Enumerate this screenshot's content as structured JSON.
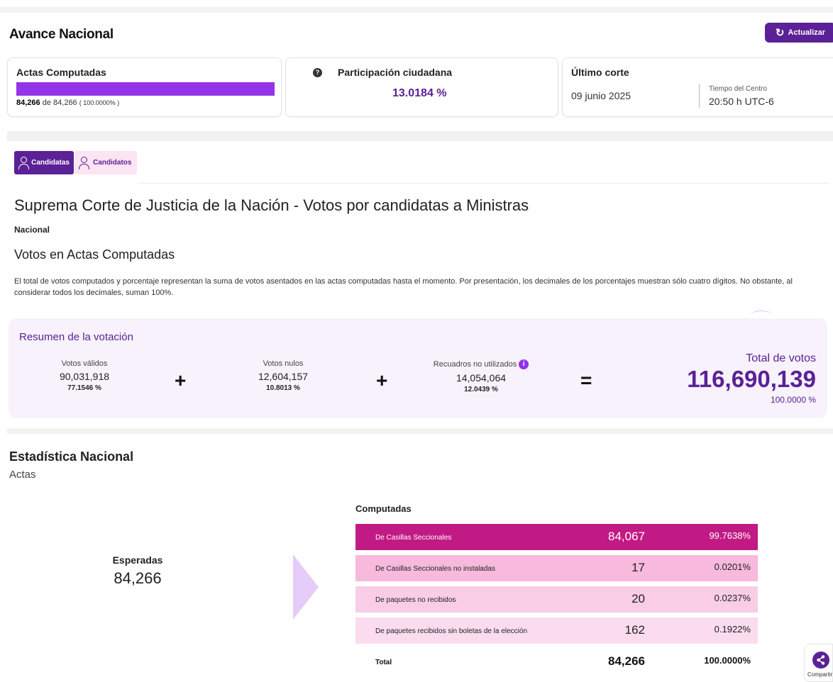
{
  "header": {
    "title": "Avance Nacional",
    "refresh_label": "Actualizar"
  },
  "actas": {
    "title": "Actas Computadas",
    "progress_fraction": 1.0,
    "computed": "84,266",
    "connector": "de",
    "total": "84,266",
    "percent": "( 100.0000% )"
  },
  "participacion": {
    "title": "Participación ciudadana",
    "value": "13.0184 %"
  },
  "corte": {
    "title": "Último corte",
    "date": "09 junio 2025",
    "time_label": "Tiempo del Centro",
    "time": "20:50 h UTC-6"
  },
  "tabs": [
    {
      "label": "Candidatas",
      "active": true
    },
    {
      "label": "Candidatos",
      "active": false
    }
  ],
  "content": {
    "title": "Suprema Corte de Justicia de la Nación - Votos por candidatas a Ministras",
    "scope": "Nacional",
    "subtitle": "Votos en Actas Computadas",
    "description": "El total de votos computados y porcentaje representan la suma de votos asentados en las actas computadas hasta el momento. Por presentación, los decimales de los porcentajes muestran sólo cuatro dígitos. No obstante, al considerar todos los decimales, suman 100%."
  },
  "resumen": {
    "title": "Resumen de la votación",
    "validos": {
      "label": "Votos válidos",
      "value": "90,031,918",
      "percent": "77.1546 %"
    },
    "nulos": {
      "label": "Votos nulos",
      "value": "12,604,157",
      "percent": "10.8013 %"
    },
    "no_utilizados": {
      "label": "Recuadros no utilizados",
      "value": "14,054,064",
      "percent": "12.0439 %"
    },
    "plus": "+",
    "equals": "=",
    "total": {
      "label": "Total de votos",
      "value": "116,690,139",
      "percent": "100.0000 %"
    }
  },
  "estadistica": {
    "title": "Estadística Nacional",
    "subtitle": "Actas",
    "esperadas_label": "Esperadas",
    "esperadas_value": "84,266",
    "computadas_label": "Computadas",
    "rows": [
      {
        "name": "De Casillas Seccionales",
        "value": "84,067",
        "percent": "99.7638%"
      },
      {
        "name": "De Casillas Seccionales no instaladas",
        "value": "17",
        "percent": "0.0201%"
      },
      {
        "name": "De paquetes no recibidos",
        "value": "20",
        "percent": "0.0237%"
      },
      {
        "name": "De paquetes recibidos sin boletas de la elección",
        "value": "162",
        "percent": "0.1922%"
      }
    ],
    "total": {
      "name": "Total",
      "value": "84,266",
      "percent": "100.0000%"
    }
  },
  "share": {
    "label": "Compartir"
  },
  "colors": {
    "brand_purple": "#5b2196",
    "progress_purple": "#9333ea",
    "magenta": "#c21a84",
    "pink_light": "#f7b9dc"
  }
}
